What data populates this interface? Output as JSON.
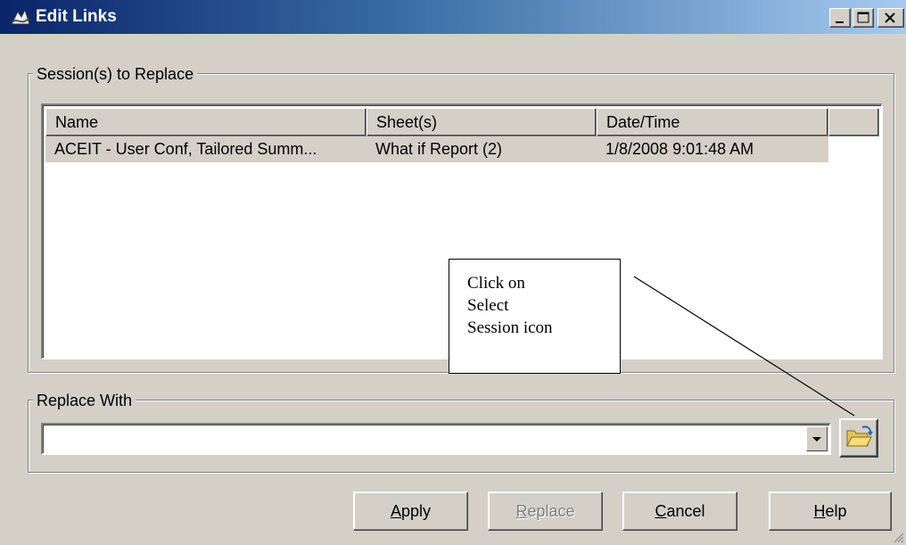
{
  "window": {
    "title": "Edit Links",
    "controls": {
      "minimize": "_",
      "maximize": "□",
      "close": "×"
    }
  },
  "sessions_group": {
    "label": "Session(s) to Replace",
    "columns": [
      "Name",
      "Sheet(s)",
      "Date/Time"
    ],
    "rows": [
      {
        "name": "ACEIT - User Conf, Tailored Summ...",
        "sheets": "What if Report (2)",
        "datetime": "1/8/2008 9:01:48 AM",
        "selected": true
      }
    ]
  },
  "replace_group": {
    "label": "Replace With",
    "combo_value": "",
    "folder_icon": "select-session-folder-icon"
  },
  "buttons": {
    "apply": {
      "mnemonic": "A",
      "rest": "pply"
    },
    "replace": {
      "mnemonic": "R",
      "rest": "eplace",
      "disabled": true
    },
    "cancel": {
      "mnemonic": "C",
      "rest": "ancel"
    },
    "help": {
      "mnemonic": "H",
      "rest": "elp"
    }
  },
  "callout": {
    "lines": [
      "Click on",
      "Select",
      "Session icon"
    ]
  },
  "colors": {
    "face": "#d4d0c8",
    "title_start": "#0a246a",
    "title_end": "#a6caf0",
    "disabled_text": "#808080"
  }
}
